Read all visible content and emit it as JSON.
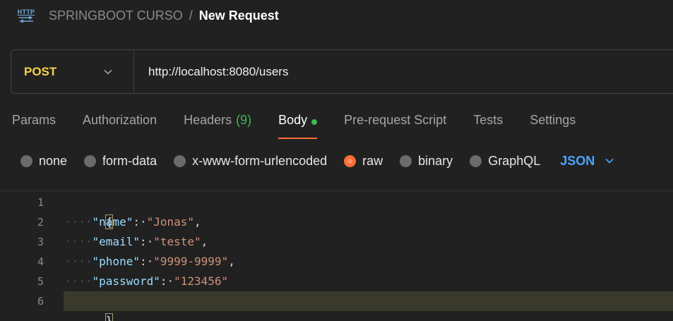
{
  "header": {
    "icon": "http-icon",
    "icon_text": "HTTP",
    "collection": "SPRINGBOOT CURSO",
    "separator": "/",
    "title": "New Request"
  },
  "request": {
    "method": "POST",
    "url": "http://localhost:8080/users"
  },
  "tabs": [
    {
      "label": "Params"
    },
    {
      "label": "Authorization"
    },
    {
      "label": "Headers",
      "count": "(9)"
    },
    {
      "label": "Body",
      "active": true
    },
    {
      "label": "Pre-request Script"
    },
    {
      "label": "Tests"
    },
    {
      "label": "Settings"
    }
  ],
  "body_modes": [
    {
      "label": "none"
    },
    {
      "label": "form-data"
    },
    {
      "label": "x-www-form-urlencoded"
    },
    {
      "label": "raw",
      "selected": true
    },
    {
      "label": "binary"
    },
    {
      "label": "GraphQL"
    }
  ],
  "language": "JSON",
  "editor": {
    "line_numbers": [
      "1",
      "2",
      "3",
      "4",
      "5",
      "6"
    ],
    "open_brace": "{",
    "close_brace": "}",
    "fields": [
      {
        "key": "\"name\"",
        "value": "\"Jonas\"",
        "comma": ","
      },
      {
        "key": "\"email\"",
        "value": "\"teste\"",
        "comma": ","
      },
      {
        "key": "\"phone\"",
        "value": "\"9999-9999\"",
        "comma": ","
      },
      {
        "key": "\"password\"",
        "value": "\"123456\"",
        "comma": ""
      }
    ]
  },
  "colors": {
    "accent": "#ff6c37",
    "method": "#f5d24a",
    "link": "#4aa3ff",
    "success": "#3fb950"
  }
}
